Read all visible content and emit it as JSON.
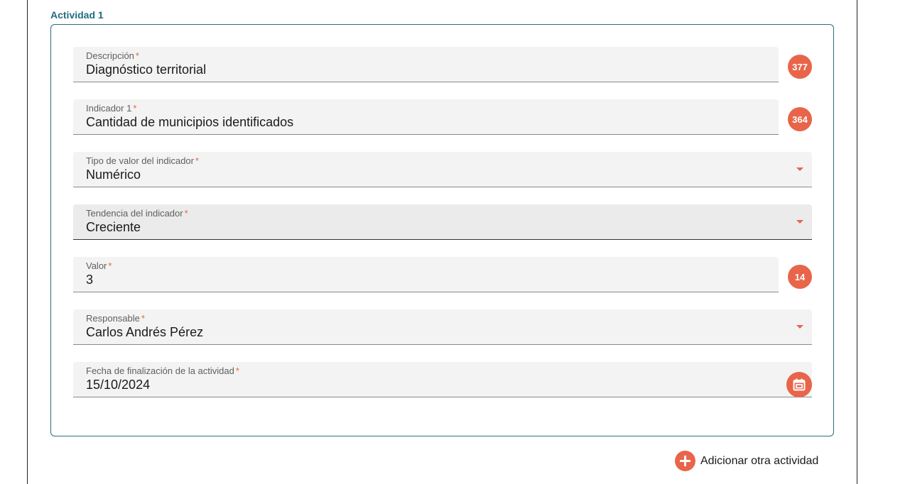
{
  "section": {
    "title": "Actividad 1"
  },
  "fields": {
    "descripcion": {
      "label": "Descripción",
      "required": "*",
      "value": "Diagnóstico territorial",
      "counter": "377"
    },
    "indicador": {
      "label": "Indicador 1",
      "required": "*",
      "value": "Cantidad de municipios identificados",
      "counter": "364"
    },
    "tipo_valor": {
      "label": "Tipo de valor del indicador",
      "required": "*",
      "value": "Numérico"
    },
    "tendencia": {
      "label": "Tendencia del indicador",
      "required": "*",
      "value": "Creciente"
    },
    "valor": {
      "label": "Valor",
      "required": "*",
      "value": "3",
      "counter": "14"
    },
    "responsable": {
      "label": "Responsable",
      "required": "*",
      "value": "Carlos Andrés Pérez"
    },
    "fecha": {
      "label": "Fecha de finalización de la actividad",
      "required": "*",
      "value": "15/10/2024"
    }
  },
  "actions": {
    "add_activity": "Adicionar otra actividad"
  },
  "icons": {
    "dropdown": "chevron-down-icon",
    "calendar": "calendar-icon",
    "add": "plus-circle-icon"
  },
  "colors": {
    "accent": "#e8654a",
    "title": "#1f6c80",
    "card_border": "#2b6d7d"
  }
}
